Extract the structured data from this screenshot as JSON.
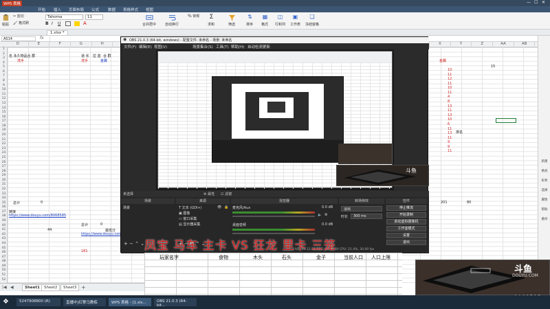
{
  "wps": {
    "app_name": "WPS 表格",
    "ribbon_tabs": [
      "开始",
      "插入",
      "页面布局",
      "公式",
      "数据",
      "表格样式",
      "视图"
    ],
    "ribbon_buttons": [
      {
        "label": "粘贴",
        "icon": "paste-icon"
      },
      {
        "label": "剪切",
        "icon": "cut-icon"
      },
      {
        "label": "格式刷",
        "icon": "format-painter-icon"
      },
      {
        "label": "合并居中",
        "icon": "merge-center-icon"
      },
      {
        "label": "自动换行",
        "icon": "wrap-text-icon"
      },
      {
        "label": "常规",
        "icon": "number-format-icon"
      },
      {
        "label": "条件格式",
        "icon": "conditional-format-icon"
      },
      {
        "label": "表格样式",
        "icon": "table-style-icon"
      },
      {
        "label": "求和",
        "icon": "sum-icon"
      },
      {
        "label": "筛选",
        "icon": "filter-icon"
      },
      {
        "label": "排序",
        "icon": "sort-icon"
      },
      {
        "label": "格式",
        "icon": "format-icon"
      },
      {
        "label": "行和列",
        "icon": "rows-cols-icon"
      },
      {
        "label": "工作表",
        "icon": "worksheet-icon"
      },
      {
        "label": "冻结窗格",
        "icon": "freeze-panes-icon"
      }
    ],
    "font_name": "Tahoma",
    "font_size": "11",
    "doc_tab": "1.xlsx *",
    "name_box": "AS14",
    "col_headers": [
      "D",
      "E",
      "F",
      "G",
      "H",
      "I",
      "J",
      "K",
      "L",
      "M",
      "N",
      "O",
      "P",
      "Q",
      "R",
      "S",
      "T",
      "U",
      "V",
      "W",
      "X",
      "Y",
      "Z",
      "AA",
      "AB"
    ],
    "row_headers": [
      "1",
      "2",
      "3",
      "4",
      "5",
      "6",
      "7",
      "8",
      "9",
      "10",
      "11",
      "12",
      "13",
      "14",
      "15",
      "16",
      "17",
      "18",
      "19",
      "20",
      "21",
      "22",
      "23",
      "24",
      "25",
      "26",
      "27",
      "28",
      "29",
      "30",
      "31",
      "32",
      "33",
      "34",
      "35",
      "36",
      "37",
      "38",
      "39",
      "40",
      "41",
      "42",
      "43",
      "44",
      "45",
      "46",
      "47",
      "48",
      "49",
      "50",
      "51",
      "52"
    ],
    "cells": {
      "left_header": "名 永久物品合 群",
      "left_red": "洗手",
      "mid_header_1": "道 长",
      "mid_header_2": "拉 蓝",
      "mid_header_3": "合 群",
      "mid_red_1": "洗手",
      "mid_blue_1": "金翼",
      "total_label": "总计",
      "total_value": "0",
      "link_label": "链接",
      "link_value": "https://www.douyu.com/8068585",
      "value_44": "44",
      "total_label_2": "总计",
      "value_0": "0",
      "min_label": "最低分",
      "link_value_2": "https://www.douyu.com/8068585",
      "red_value": "181",
      "right_gold": "金翼",
      "right_15": "15",
      "right_values": [
        "10",
        "11",
        "12",
        "11",
        "10",
        "11",
        "4",
        "8",
        "13",
        "11",
        "13",
        "10",
        "6",
        "11",
        "13",
        "11",
        "9",
        "9",
        "11"
      ],
      "right_label": "排名",
      "right_201": "201",
      "right_80": "80"
    },
    "sheet_tabs": [
      "Sheet1",
      "Sheet2",
      "Sheet3"
    ],
    "right_panel": [
      "新建",
      "格式",
      "形状",
      "选择",
      "属性",
      "帮助",
      "备份"
    ]
  },
  "obs": {
    "title": "OBS 21.0.3 (64-bit, windows) - 配置文件: 未命名 - 场景: 未命名",
    "menu": [
      "文件(F)",
      "编辑(E)",
      "视图(V)",
      "场景集合(S)",
      "工具(T)",
      "帮助(H)",
      "自动检测更新"
    ],
    "docks": {
      "scenes_header": "场景",
      "sources_header": "来源",
      "mixer_header": "混音器",
      "transitions_header": "转场特效",
      "controls_header": "控件",
      "scene_item": "场景",
      "sources": [
        "文本 (GDI+)",
        "图像",
        "窗口采集",
        "显示器采集"
      ],
      "mixer_tracks": [
        {
          "name": "麦克风/Aux",
          "db": "0.0 dB"
        },
        {
          "name": "桌面音频",
          "db": "0.0 dB"
        }
      ],
      "transition_select": "淡出",
      "duration_label": "时长",
      "duration_value": "300 ms",
      "controls": [
        "停止推流",
        "开始录制",
        "启动虚拟摄像机",
        "工作室模式",
        "设置",
        "退出"
      ],
      "status": "LIVE: 00:12:31  REC: 00:00:00  CPU: 21.4%, 30.00 fps",
      "selected_toggle": "未选择",
      "toggle_a": "属性",
      "toggle_b": "滤镜"
    }
  },
  "overlay": {
    "marquee": "凤宝 马车 主卡 VS 狂龙 里卡 三笼",
    "table_headers": [
      "玩家名字",
      "食物",
      "木头",
      "石头",
      "金子",
      "当前人口",
      "人口上限"
    ],
    "douyu_text": "DOUYU.COM",
    "room_id": "8068585"
  },
  "taskbar": {
    "items": [
      "5247908800 (R)",
      "直播中|红警马教练",
      "WPS 表格 - [1.xls...",
      "OBS 21.0.3 (64-bit..."
    ]
  },
  "colors": {
    "red": "#d41c1c",
    "blue": "#2040c0",
    "wps_title": "#35495f",
    "obs_bg": "#2b2b2b"
  }
}
